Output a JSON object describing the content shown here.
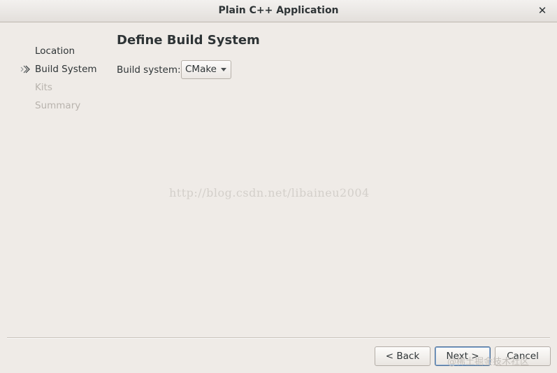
{
  "window": {
    "title": "Plain C++ Application",
    "close_glyph": "✕"
  },
  "nav": {
    "items": [
      {
        "label": "Location",
        "state": "done"
      },
      {
        "label": "Build System",
        "state": "current",
        "icon": "arrow-right-icon"
      },
      {
        "label": "Kits",
        "state": "future"
      },
      {
        "label": "Summary",
        "state": "future"
      }
    ]
  },
  "page": {
    "title": "Define Build System",
    "build_system_label": "Build system:",
    "build_system_value": "CMake"
  },
  "watermark": "http://blog.csdn.net/libaineu2004",
  "footer_watermark": "@稀土掘金技术社区",
  "buttons": {
    "back": "< Back",
    "next": "Next >",
    "cancel": "Cancel"
  },
  "colors": {
    "background": "#efebe7",
    "default_button_border": "#4a6e97",
    "disabled_text": "#b8b3ad"
  }
}
